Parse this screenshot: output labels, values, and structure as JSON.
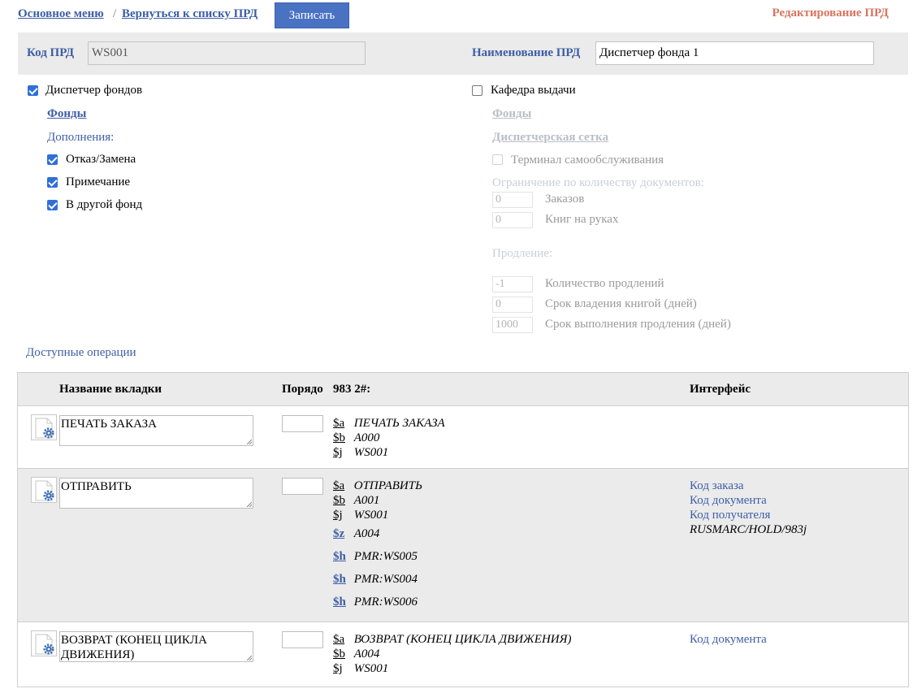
{
  "nav": {
    "main_menu": "Основное меню",
    "separator": "/",
    "back": "Вернуться к списку ПРД",
    "save_button": "Записать",
    "page_title": "Редактирование ПРД"
  },
  "code_panel": {
    "code_label": "Код ПРД",
    "code_value": "WS001",
    "name_label": "Наименование ПРД",
    "name_value": "Диспетчер фонда 1"
  },
  "left": {
    "dispatcher_label": "Диспетчер фондов",
    "dispatcher_checked": true,
    "funds_link": "Фонды",
    "additions_label": "Дополнения:",
    "options": [
      {
        "label": "Отказ/Замена",
        "checked": true
      },
      {
        "label": "Примечание",
        "checked": true
      },
      {
        "label": "В другой фонд",
        "checked": true
      }
    ]
  },
  "right": {
    "desk_label": "Кафедра выдачи",
    "desk_checked": false,
    "funds_link": "Фонды",
    "grid_link": "Диспетчерская сетка",
    "terminal_label": "Терминал самообслуживания",
    "limit_label": "Ограничение по количеству документов:",
    "orders_value": "0",
    "orders_label": "Заказов",
    "books_value": "0",
    "books_label": "Книг на руках",
    "renewal_label": "Продление:",
    "renew_count_value": "-1",
    "renew_count_label": "Количество продлений",
    "hold_days_value": "0",
    "hold_days_label": "Срок владения книгой (дней)",
    "exec_days_value": "1000",
    "exec_days_label": "Срок выполнения продления (дней)"
  },
  "operations_label": "Доступные операции",
  "table": {
    "headers": {
      "tab_name": "Название вкладки",
      "order": "Порядо",
      "field": "983 2#:",
      "interface": "Интерфейс"
    },
    "rows": [
      {
        "tab_name": "ПЕЧАТЬ ЗАКАЗА",
        "subfields": [
          {
            "code": "$a",
            "value": "ПЕЧАТЬ ЗАКАЗА"
          },
          {
            "code": "$b",
            "value": "A000"
          },
          {
            "code": "$j",
            "value": "WS001"
          }
        ],
        "extra": [],
        "interface": [],
        "interface_path": ""
      },
      {
        "tab_name": "ОТПРАВИТЬ",
        "subfields": [
          {
            "code": "$a",
            "value": "ОТПРАВИТЬ"
          },
          {
            "code": "$b",
            "value": "A001"
          },
          {
            "code": "$j",
            "value": "WS001"
          }
        ],
        "extra": [
          {
            "code": "$z",
            "value": "A004"
          },
          {
            "code": "$h",
            "value": "PMR:WS005"
          },
          {
            "code": "$h",
            "value": "PMR:WS004"
          },
          {
            "code": "$h",
            "value": "PMR:WS006"
          }
        ],
        "interface": [
          "Код заказа",
          "Код документа",
          "Код получателя"
        ],
        "interface_path": "RUSMARC/HOLD/983j"
      },
      {
        "tab_name": "ВОЗВРАТ (КОНЕЦ ЦИКЛА ДВИЖЕНИЯ)",
        "subfields": [
          {
            "code": "$a",
            "value": "ВОЗВРАТ (КОНЕЦ ЦИКЛА ДВИЖЕНИЯ)"
          },
          {
            "code": "$b",
            "value": "A004"
          },
          {
            "code": "$j",
            "value": "WS001"
          }
        ],
        "extra": [],
        "interface": [
          "Код документа"
        ],
        "interface_path": ""
      }
    ]
  },
  "colors": {
    "link": "#3d5ea6",
    "button": "#4a72c2",
    "title": "#d9745e",
    "panel": "#ebebeb",
    "checkbox": "#2f6fd8"
  }
}
